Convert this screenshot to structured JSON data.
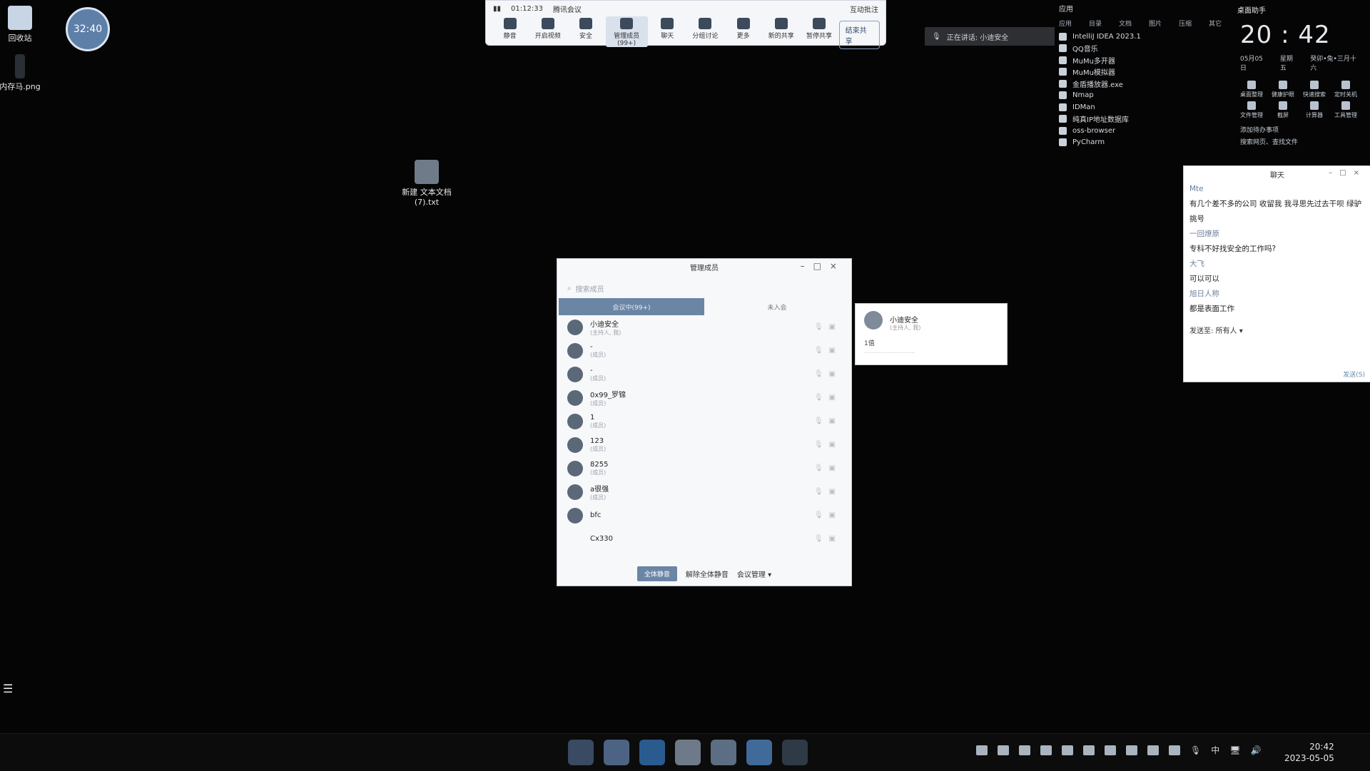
{
  "desktop": {
    "icons": [
      {
        "label": "回收站"
      },
      {
        "label": "内存马.png"
      },
      {
        "label": "新建 文本文档 (7).txt"
      }
    ],
    "timer_badge": "32:40"
  },
  "meeting_bar": {
    "elapsed": "01:12:33",
    "meeting_name": "腾讯会议",
    "interactive_annotation": "互动批注",
    "tools": [
      {
        "label": "静音",
        "icon": "mic-icon"
      },
      {
        "label": "开启视频",
        "icon": "camera-icon"
      },
      {
        "label": "安全",
        "icon": "shield-icon"
      },
      {
        "label": "管理成员(99+)",
        "icon": "members-icon",
        "active": true
      },
      {
        "label": "聊天",
        "icon": "chat-icon"
      },
      {
        "label": "分组讨论",
        "icon": "breakout-icon"
      },
      {
        "label": "更多",
        "icon": "more-icon"
      },
      {
        "label": "新的共享",
        "icon": "share-icon"
      },
      {
        "label": "暂停共享",
        "icon": "pause-share-icon"
      }
    ],
    "end_share": "结束共享"
  },
  "speaking_banner": "正在讲话: 小迪安全",
  "app_panel": {
    "title": "应用",
    "tabs": [
      "应用",
      "目录",
      "文档",
      "图片",
      "压缩",
      "其它"
    ],
    "apps": [
      "IntelliJ IDEA 2023.1",
      "QQ音乐",
      "MuMu多开器",
      "MuMu模拟器",
      "金盾播放器.exe",
      "Nmap",
      "IDMan",
      "纯真IP地址数据库",
      "oss-browser",
      "PyCharm"
    ]
  },
  "clock_panel": {
    "title": "桌面助手",
    "time_h": "20",
    "time_m": "42",
    "date": "05月05日",
    "weekday": "星期五",
    "lunar": "癸卯•兔•三月十六",
    "quick": [
      "桌面整理",
      "健康护眼",
      "快速搜索",
      "定时关机",
      "文件管理",
      "截屏",
      "计算器",
      "工具管理"
    ],
    "todo": "添加待办事项",
    "search": "搜索网页、查找文件"
  },
  "chat": {
    "title": "聊天",
    "messages": [
      {
        "name": "Mte",
        "text": "有几个差不多的公司 收留我  我寻思先过去干呗  绿驴"
      },
      {
        "name": "",
        "text": "挑号"
      },
      {
        "name": "一回燎原",
        "text": ""
      },
      {
        "name": "",
        "text": "专科不好找安全的工作吗?"
      },
      {
        "name": "大飞",
        "text": ""
      },
      {
        "name": "",
        "text": "可以可以"
      },
      {
        "name": "旭日人称",
        "text": ""
      },
      {
        "name": "",
        "text": "都是表面工作"
      }
    ],
    "send_to_label": "发送至:",
    "send_to_value": "所有人",
    "send_button": "发送(S)"
  },
  "member_dialog": {
    "title": "管理成员",
    "search_placeholder": "搜索成员",
    "tab_active": "会议中(99+)",
    "tab_other": "未入会",
    "members": [
      {
        "name": "小迪安全",
        "sub": "(主持人, 我)"
      },
      {
        "name": "-",
        "sub": "(成员)"
      },
      {
        "name": "-",
        "sub": "(成员)"
      },
      {
        "name": "0x99_罗锦",
        "sub": "(成员)"
      },
      {
        "name": "1",
        "sub": "(成员)"
      },
      {
        "name": "123",
        "sub": "(成员)"
      },
      {
        "name": "8255",
        "sub": "(成员)"
      },
      {
        "name": "a很强",
        "sub": "(成员)"
      },
      {
        "name": "bfc",
        "sub": ""
      },
      {
        "name": "Cx330",
        "sub": ""
      }
    ],
    "mute_all": "全体静音",
    "unmute_all": "解除全体静音",
    "meeting_manage": "会议管理"
  },
  "member_card": {
    "name": "小迪安全",
    "sub": "(主持人, 我)",
    "line1": "1值",
    "line2": "............................"
  },
  "taskbar": {
    "time": "20:42",
    "date": "2023-05-05",
    "ime": "中",
    "apps": [
      "explorer-icon",
      "folder-icon",
      "edge-icon",
      "chrome-icon",
      "app-icon",
      "meeting-icon",
      "pycharm-icon"
    ]
  }
}
